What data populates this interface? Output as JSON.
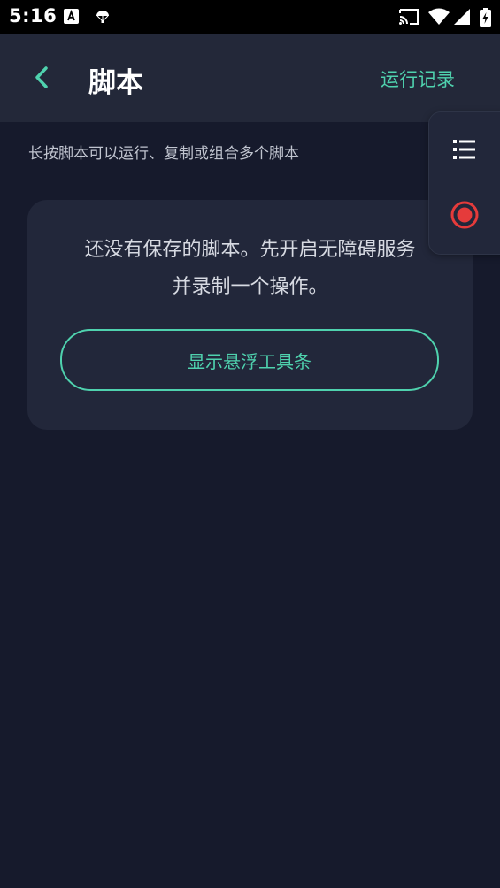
{
  "status_bar": {
    "time": "5:16",
    "left_icons": [
      "text-a-icon",
      "parachute-icon"
    ],
    "right_icons": [
      "cast-icon",
      "wifi-icon",
      "signal-icon",
      "battery-charging-icon"
    ]
  },
  "app_bar": {
    "back_icon": "chevron-left-icon",
    "title": "脚本",
    "history_label": "运行记录"
  },
  "hint": "长按脚本可以运行、复制或组合多个脚本",
  "empty_state": {
    "message": "还没有保存的脚本。先开启无障碍服务\n并录制一个操作。",
    "button_label": "显示悬浮工具条"
  },
  "float_toolbar": {
    "list_icon": "list-icon",
    "record_icon": "record-icon"
  },
  "colors": {
    "background": "#161a2c",
    "app_bar": "#232839",
    "card": "#22273a",
    "accent": "#4fd2ae",
    "record": "#e53b3b"
  }
}
